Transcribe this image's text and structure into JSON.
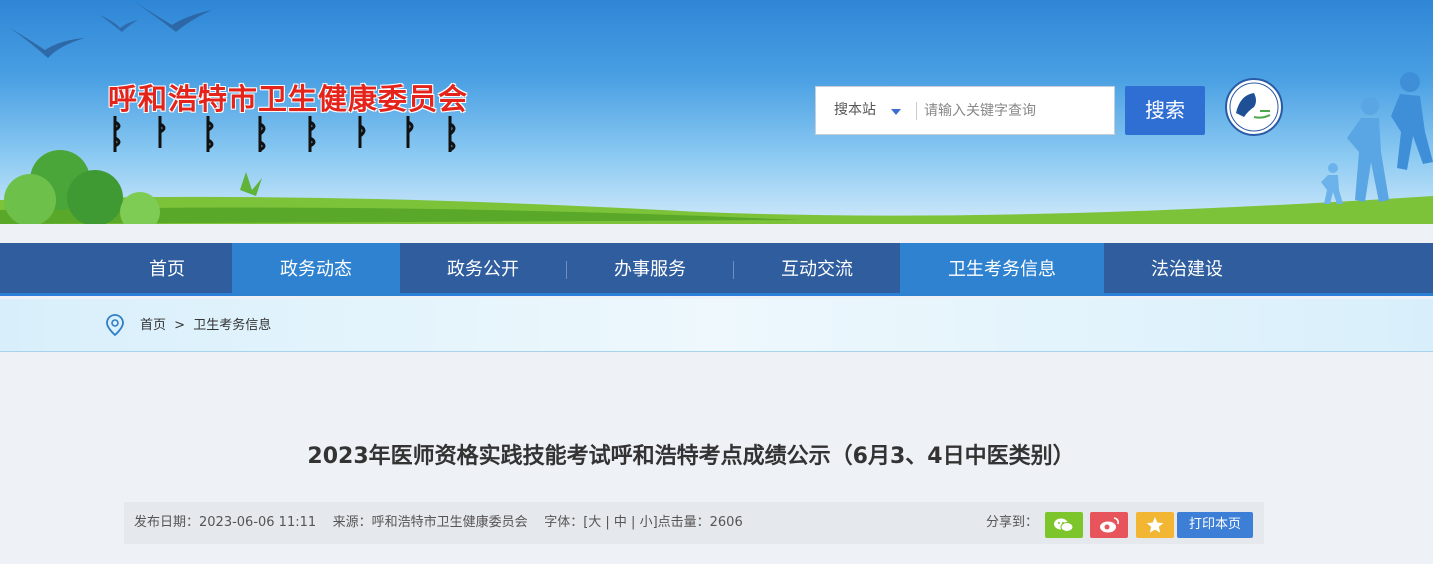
{
  "header": {
    "site_title": "呼和浩特市卫生健康委员会",
    "search": {
      "scope_label": "搜本站",
      "placeholder": "请输入关键字查询",
      "button_label": "搜索"
    }
  },
  "nav": {
    "items": [
      {
        "label": "首页"
      },
      {
        "label": "政务动态"
      },
      {
        "label": "政务公开"
      },
      {
        "label": "办事服务"
      },
      {
        "label": "互动交流"
      },
      {
        "label": "卫生考务信息"
      },
      {
        "label": "法治建设"
      }
    ],
    "active_items": [
      "政务动态",
      "卫生考务信息"
    ]
  },
  "breadcrumb": {
    "home": "首页",
    "separator": ">",
    "current": "卫生考务信息"
  },
  "article": {
    "title": "2023年医师资格实践技能考试呼和浩特考点成绩公示（6月3、4日中医类别）",
    "meta": "发布日期：2023-06-06 11:11    来源：呼和浩特市卫生健康委员会    字体：[大 | 中 | 小]点击量：2606",
    "share_label": "分享到：",
    "print_label": "打印本页"
  },
  "colors": {
    "title_red": "#e4241b",
    "nav_bg": "#2f5d9e",
    "nav_active": "#2f82cf",
    "search_btn": "#2f6fd4",
    "wechat": "#7cc52b",
    "weibo": "#e8545b",
    "favorite": "#f2b632",
    "print_btn": "#3d7fd6"
  },
  "icons": [
    "location-pin-icon",
    "caret-down-icon",
    "wechat-icon",
    "weibo-icon",
    "star-icon",
    "emblem-logo"
  ]
}
